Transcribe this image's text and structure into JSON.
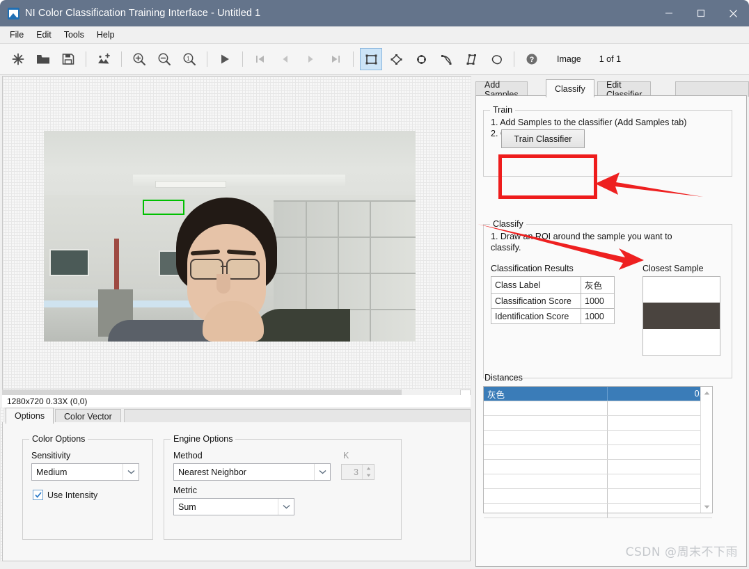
{
  "window": {
    "title": "NI Color Classification Training Interface - Untitled 1",
    "app_icon": "image-app-icon",
    "minimize": "−",
    "maximize": "□",
    "close": "✕",
    "titlebar_color": "#64748b"
  },
  "menubar": {
    "items": [
      {
        "label": "File"
      },
      {
        "label": "Edit"
      },
      {
        "label": "Tools"
      },
      {
        "label": "Help"
      }
    ]
  },
  "toolbar": {
    "buttons": [
      {
        "icon": "new-icon",
        "label": "New"
      },
      {
        "icon": "open-folder-icon",
        "label": "Open"
      },
      {
        "icon": "save-floppy-icon",
        "label": "Save"
      },
      {
        "icon": "add-image-icon",
        "label": "Add Image"
      },
      {
        "icon": "zoom-in-icon",
        "label": "Zoom In"
      },
      {
        "icon": "zoom-out-icon",
        "label": "Zoom Out"
      },
      {
        "icon": "zoom-actual-icon",
        "label": "Zoom 1:1"
      },
      {
        "icon": "play-icon",
        "label": "Play"
      },
      {
        "icon": "first-image-icon",
        "label": "First"
      },
      {
        "icon": "previous-image-icon",
        "label": "Previous"
      },
      {
        "icon": "next-image-icon",
        "label": "Next"
      },
      {
        "icon": "last-image-icon",
        "label": "Last"
      },
      {
        "icon": "roi-rectangle-icon",
        "label": "Rectangle ROI"
      },
      {
        "icon": "roi-rotated-rect-icon",
        "label": "Rotated Rectangle ROI"
      },
      {
        "icon": "roi-oval-icon",
        "label": "Oval ROI"
      },
      {
        "icon": "roi-annulus-icon",
        "label": "Annulus ROI"
      },
      {
        "icon": "roi-polygon-icon",
        "label": "Polygon ROI"
      },
      {
        "icon": "roi-freehand-icon",
        "label": "Freehand ROI"
      },
      {
        "icon": "help-icon",
        "label": "Help"
      }
    ],
    "image_label": "Image",
    "image_count": "1 of 1",
    "selected_tool": "roi-rectangle-icon"
  },
  "canvas": {
    "roi": {
      "color": "#00c000"
    },
    "status": "1280x720 0.33X   (0,0)"
  },
  "bottom_tabs": {
    "tabs": [
      {
        "label": "Options",
        "active": true
      },
      {
        "label": "Color Vector",
        "active": false
      }
    ],
    "color_options": {
      "title": "Color Options",
      "sensitivity_label": "Sensitivity",
      "sensitivity_value": "Medium",
      "use_intensity_label": "Use Intensity",
      "use_intensity_checked": true
    },
    "engine_options": {
      "title": "Engine Options",
      "method_label": "Method",
      "method_value": "Nearest Neighbor",
      "k_label": "K",
      "k_value": "3",
      "metric_label": "Metric",
      "metric_value": "Sum"
    }
  },
  "right_panel": {
    "tabs": [
      {
        "label": "Add Samples",
        "active": false
      },
      {
        "label": "Classify",
        "active": true
      },
      {
        "label": "Edit Classifier",
        "active": false
      }
    ],
    "train": {
      "title": "Train",
      "step1": "1. Add Samples to the classifier (Add Samples tab)",
      "step2": "2. Click Train Classifier",
      "button_label": "Train Classifier",
      "highlight_color": "#ee1c1c"
    },
    "classify": {
      "title": "Classify",
      "step1_line1": "1. Draw an ROI around the sample you want to",
      "step1_line2": "classify.",
      "results_title": "Classification Results",
      "results_rows": [
        {
          "name": "Class Label",
          "value": "灰色"
        },
        {
          "name": "Classification Score",
          "value": "1000"
        },
        {
          "name": "Identification Score",
          "value": "1000"
        }
      ],
      "closest_sample_title": "Closest Sample",
      "closest_sample_color": "#4a443f"
    },
    "distances": {
      "title": "Distances",
      "rows": [
        {
          "name": "灰色",
          "value": "0.0",
          "selected": true
        },
        {
          "name": "",
          "value": "",
          "selected": false
        },
        {
          "name": "",
          "value": "",
          "selected": false
        },
        {
          "name": "",
          "value": "",
          "selected": false
        },
        {
          "name": "",
          "value": "",
          "selected": false
        },
        {
          "name": "",
          "value": "",
          "selected": false
        },
        {
          "name": "",
          "value": "",
          "selected": false
        },
        {
          "name": "",
          "value": "",
          "selected": false
        },
        {
          "name": "",
          "value": "",
          "selected": false
        }
      ],
      "selection_color": "#3a7cb8",
      "scroll_up": "scroll-up-arrow-icon",
      "scroll_down": "scroll-down-arrow-icon"
    }
  },
  "watermark": {
    "text": "CSDN @周末不下雨"
  }
}
